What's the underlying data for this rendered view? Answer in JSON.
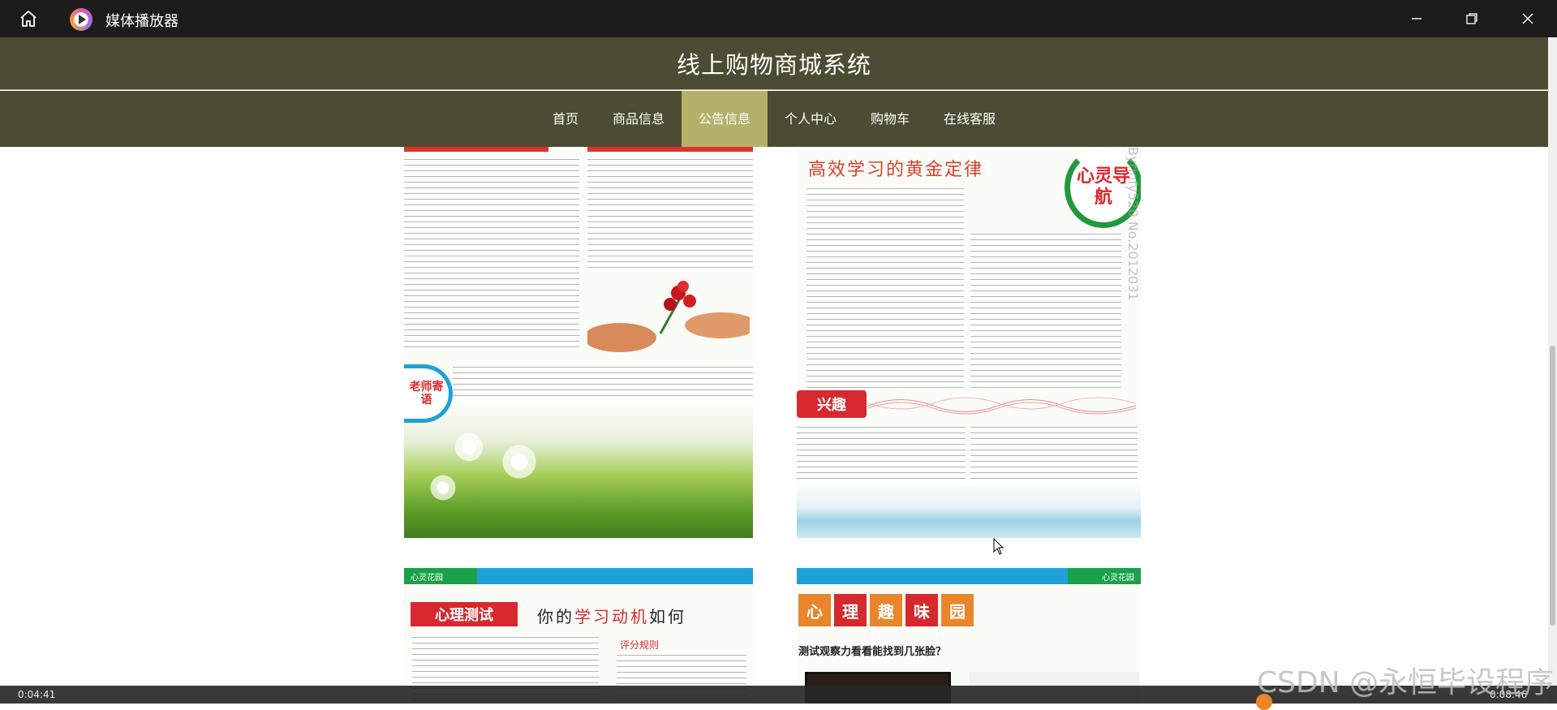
{
  "window": {
    "app_title": "媒体播放器"
  },
  "site": {
    "title": "线上购物商城系统",
    "nav": [
      {
        "label": "首页",
        "active": false
      },
      {
        "label": "商品信息",
        "active": false
      },
      {
        "label": "公告信息",
        "active": true
      },
      {
        "label": "个人中心",
        "active": false
      },
      {
        "label": "购物车",
        "active": false
      },
      {
        "label": "在线客服",
        "active": false
      }
    ]
  },
  "newspaper": {
    "teacher_badge": "老师寄语",
    "p2_heading": "高效学习的黄金定律",
    "mind_ring": "心灵导航",
    "vertical_watermark": "Bytinfy520 No.2012031",
    "interest_tag": "兴趣",
    "strip_left_text": "心灵花园",
    "strip_right_text": "心灵花园",
    "psych_tag": "心理测试",
    "p3_heading_pre": "你的",
    "p3_heading_hl": "学习动机",
    "p3_heading_post": "如何",
    "score_title": "评分规则",
    "fun_chars": [
      "心",
      "理",
      "趣",
      "味",
      "园"
    ],
    "p4_caption": "测试观察力看看能找到几张脸？"
  },
  "player": {
    "time_left": "0:04:41",
    "time_right": "0:08:46"
  },
  "watermark": "CSDN @永恒毕设程序",
  "colors": {
    "header_bg": "#4d4b33",
    "nav_active_bg": "#b4b069",
    "titlebar_bg": "#1c1c1c",
    "accent_red": "#d7282d",
    "accent_green": "#1aa24a",
    "accent_blue": "#1ea1d8"
  }
}
